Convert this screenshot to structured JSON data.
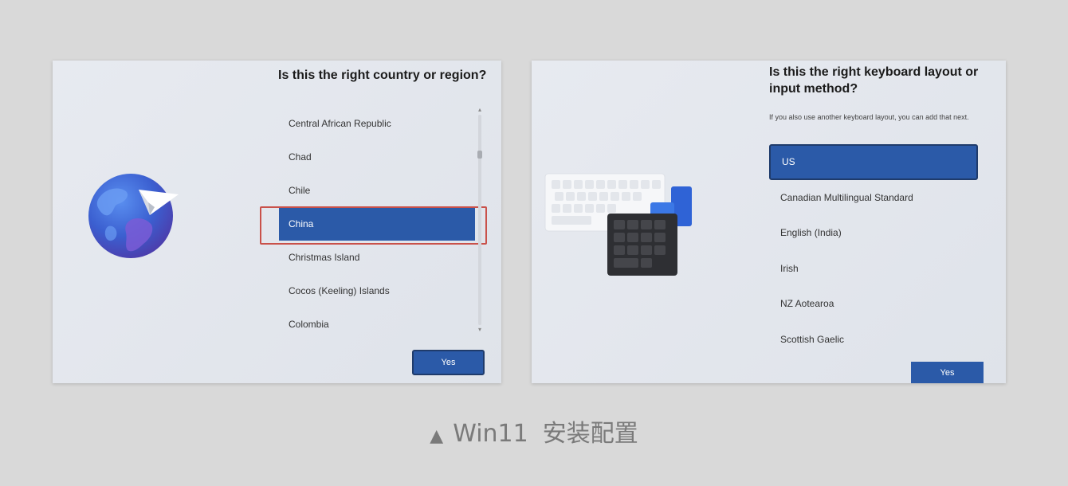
{
  "left_panel": {
    "title": "Is this the right country or region?",
    "items": [
      {
        "label": "Central African Republic",
        "selected": false
      },
      {
        "label": "Chad",
        "selected": false
      },
      {
        "label": "Chile",
        "selected": false
      },
      {
        "label": "China",
        "selected": true
      },
      {
        "label": "Christmas Island",
        "selected": false
      },
      {
        "label": "Cocos (Keeling) Islands",
        "selected": false
      },
      {
        "label": "Colombia",
        "selected": false
      }
    ],
    "button": "Yes"
  },
  "right_panel": {
    "title": "Is this the right keyboard layout or input method?",
    "subtitle": "If you also use another keyboard layout, you can add that next.",
    "items": [
      {
        "label": "US",
        "selected": true
      },
      {
        "label": "Canadian Multilingual Standard",
        "selected": false
      },
      {
        "label": "English (India)",
        "selected": false
      },
      {
        "label": "Irish",
        "selected": false
      },
      {
        "label": "NZ Aotearoa",
        "selected": false
      },
      {
        "label": "Scottish Gaelic",
        "selected": false
      }
    ],
    "button": "Yes"
  },
  "caption": {
    "marker": "▲",
    "os": "Win11",
    "text": "安装配置"
  },
  "icons": [
    "globe-icon",
    "paper-plane-icon",
    "keyboard-icon",
    "numpad-icon",
    "scroll-up-icon",
    "scroll-down-icon"
  ],
  "colors": {
    "accent": "#2b5aa8",
    "accent_border": "#1f3b6b",
    "highlight_border": "#c9514a",
    "panel_bg": "#e4e7ed",
    "page_bg": "#d9d9d9"
  }
}
